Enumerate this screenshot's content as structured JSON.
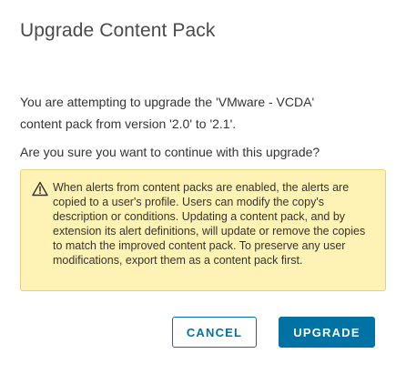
{
  "dialog": {
    "title": "Upgrade Content Pack",
    "message_line1": "You are attempting to upgrade the 'VMware - VCDA'",
    "message_line2": "content pack from version '2.0' to '2.1'.",
    "question": "Are you sure you want to continue with this upgrade?",
    "alert": {
      "icon": "warning-triangle-icon",
      "text": "When alerts from content packs are enabled, the alerts are copied to a user's profile. Users can modify the copy's description or conditions. Updating a content pack, and by extension its alert definitions, will update or remove the copies to match the improved content pack. To preserve any user modifications, export them as a content pack first."
    },
    "buttons": {
      "cancel_label": "CANCEL",
      "upgrade_label": "UPGRADE"
    }
  },
  "colors": {
    "primary": "#0072a3",
    "warning_bg": "#fef3b5",
    "warning_border": "#e6d07a"
  }
}
